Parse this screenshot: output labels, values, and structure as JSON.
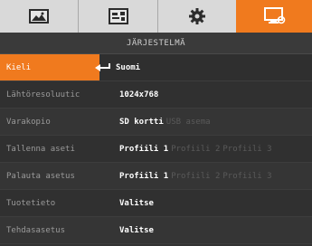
{
  "tabs": [
    {
      "icon": "image-icon",
      "active": false
    },
    {
      "icon": "display-settings-icon",
      "active": false
    },
    {
      "icon": "gear-icon",
      "active": false
    },
    {
      "icon": "system-monitor-icon",
      "active": true
    }
  ],
  "colors": {
    "accent": "#f07a1e",
    "background": "#333333",
    "tab_bar": "#d9d9d9",
    "text_active": "#ffffff",
    "text_label": "#9a9a9a",
    "text_dim": "#5a5a5a"
  },
  "section_title": "JÄRJESTELMÄ",
  "menu": [
    {
      "label": "Kieli",
      "arrow_icon": "return-arrow-icon",
      "values": [
        "Suomi"
      ],
      "active_index": 0
    },
    {
      "label": "Lähtöresoluutic",
      "values": [
        "1024x768"
      ],
      "active_index": 0
    },
    {
      "label": "Varakopio",
      "values": [
        "SD kortti",
        "USB asema"
      ],
      "active_index": 0
    },
    {
      "label": "Tallenna aseti",
      "values": [
        "Profiili 1",
        "Profiili 2",
        "Profiili 3"
      ],
      "active_index": 0
    },
    {
      "label": "Palauta asetus",
      "values": [
        "Profiili 1",
        "Profiili 2",
        "Profiili 3"
      ],
      "active_index": 0
    },
    {
      "label": "Tuotetieto",
      "values": [
        "Valitse"
      ],
      "active_index": 0
    },
    {
      "label": "Tehdasasetus",
      "values": [
        "Valitse"
      ],
      "active_index": 0
    }
  ]
}
